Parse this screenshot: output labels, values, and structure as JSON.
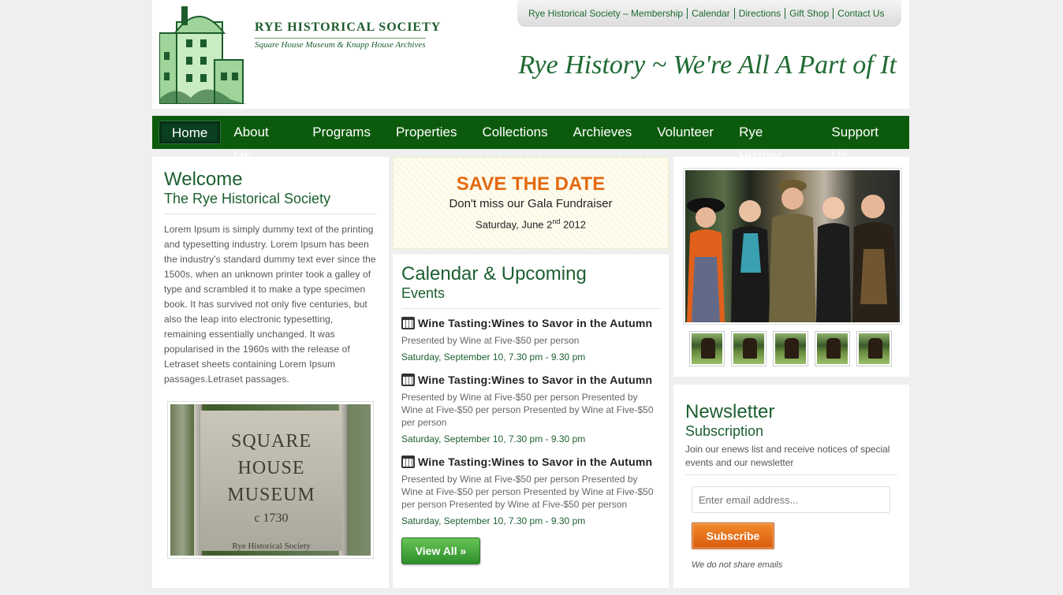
{
  "header": {
    "logo_title": "RYE HISTORICAL SOCIETY",
    "logo_subtitle": "Square House Museum & Knapp House Archives",
    "tagline": "Rye History ~ We're All A Part of It",
    "top_links": [
      "Rye Historical Society – Membership",
      "Calendar",
      "Directions",
      "Gift Shop",
      "Contact Us"
    ]
  },
  "nav": {
    "items": [
      "Home",
      "About Us",
      "Programs",
      "Properties",
      "Collections",
      "Archieves",
      "Volunteer",
      "Rye History",
      "Support Us"
    ],
    "active": "Home"
  },
  "welcome": {
    "title": "Welcome",
    "subtitle": "The Rye Historical Society",
    "body": "Lorem Ipsum is simply dummy text of the printing and typesetting industry. Lorem Ipsum has been the industry's standard dummy text ever since the 1500s, when an unknown printer took a galley of type and scrambled it to make a type specimen book. It has survived not only five centuries, but also the leap into electronic typesetting, remaining essentially unchanged. It was popularised in the 1960s with the release of Letraset sheets containing Lorem Ipsum passages.Letraset passages.",
    "sign": {
      "line1": "SQUARE",
      "line2": "HOUSE",
      "line3": "MUSEUM",
      "line4": "c 1730",
      "line5": "Rye Historical Society"
    }
  },
  "save_the_date": {
    "headline": "SAVE THE DATE",
    "line": "Don't miss our Gala Fundraiser",
    "date_prefix": "Saturday, June 2",
    "date_sup": "nd",
    "date_suffix": " 2012"
  },
  "calendar": {
    "title": "Calendar & Upcoming",
    "subtitle": "Events",
    "events": [
      {
        "title": "Wine Tasting:Wines to Savor in the Autumn",
        "desc": "Presented by Wine at Five-$50 per person",
        "date": "Saturday, September 10, 7.30 pm - 9.30 pm"
      },
      {
        "title": "Wine Tasting:Wines to Savor in the Autumn",
        "desc": "Presented by Wine at Five-$50 per person Presented by Wine at Five-$50 per person Presented by Wine at Five-$50 per person",
        "date": "Saturday, September 10, 7.30 pm - 9.30 pm"
      },
      {
        "title": "Wine Tasting:Wines to Savor in the Autumn",
        "desc": "Presented by Wine at Five-$50 per person Presented by Wine at Five-$50 per person Presented by Wine at Five-$50 per person Presented by Wine at Five-$50 per person",
        "date": "Saturday, September 10, 7.30 pm - 9.30 pm"
      }
    ],
    "view_all_label": "View All »"
  },
  "newsletter": {
    "title": "Newsletter",
    "subtitle": "Subscription",
    "description": "Join our enews list and receive notices of special events and our newsletter",
    "email_placeholder": "Enter email address...",
    "subscribe_label": "Subscribe",
    "note": "We do not share emails"
  },
  "colors": {
    "nav_bg": "#0c5a0c",
    "accent_green": "#1c5f30",
    "accent_orange": "#e36a10"
  }
}
